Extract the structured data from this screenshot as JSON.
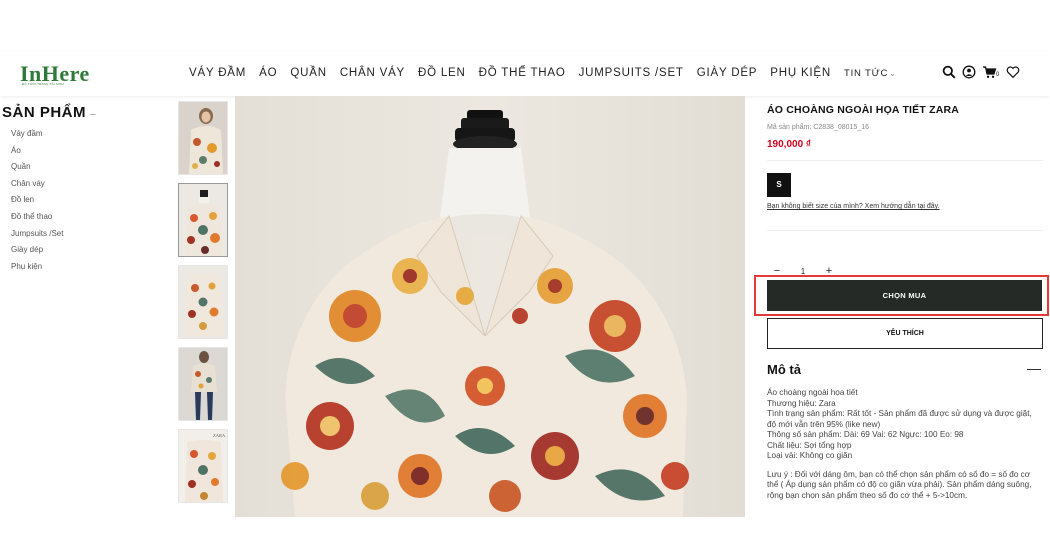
{
  "brand": {
    "logo": "InHere",
    "tagline": "ĐỒ THỜI TRANG TÁI SINH"
  },
  "nav": [
    "VÁY ĐẦM",
    "ÁO",
    "QUẦN",
    "CHÂN VÁY",
    "ĐỒ LEN",
    "ĐỒ THỂ THAO",
    "JUMPSUITS /SET",
    "GIÀY DÉP",
    "PHỤ KIỆN"
  ],
  "nav_more": "TIN TỨC",
  "header_icons": [
    "search-icon",
    "user-icon",
    "cart-icon",
    "heart-icon"
  ],
  "cart_count": "0",
  "sidebar": {
    "title": "SẢN PHẨM",
    "items": [
      "Váy đầm",
      "Áo",
      "Quần",
      "Chân váy",
      "Đồ len",
      "Đồ thể thao",
      "Jumpsuits /Set",
      "Giày dép",
      "Phụ kiện"
    ]
  },
  "product": {
    "title": "ÁO CHOÀNG NGOÀI HỌA TIẾT ZARA",
    "code_label": "Mã sản phẩm:",
    "code": "C2838_08015_16",
    "price": "190,000 ₫",
    "size": "S",
    "size_guide": "Bạn không biết size của mình? Xem hướng dẫn tại đây.",
    "qty": "1",
    "buy_label": "CHỌN MUA",
    "fav_label": "YÊU THÍCH",
    "thumb_brand": "ZARA"
  },
  "description": {
    "title": "Mô tả",
    "lines": [
      "Áo choàng ngoài họa tiết",
      "Thương hiệu: Zara",
      "Tình trạng sản phẩm: Rất tốt - Sản phẩm đã được sử dụng và được giặt, độ mới vẫn trên 95% (like new)",
      "Thông số sản phẩm: Dài: 69 Vai: 62 Ngực: 100 Eo: 98",
      "Chất liệu: Sợi tổng hợp",
      "Loại vải: Không co giãn"
    ],
    "note": "Lưu ý : Đối với dáng ôm, bạn có thể chọn sản phẩm có số đo = số đo cơ thể ( Áp dụng sản phẩm có độ co giãn vừa phải). Sản phẩm dáng suông, rộng bạn chọn sản phẩm theo số đo cơ thể + 5->10cm."
  },
  "colors": {
    "price": "#d0021b",
    "buy_button": "#252a27",
    "highlight": "#e53935",
    "logo": "#2f7a3a"
  }
}
